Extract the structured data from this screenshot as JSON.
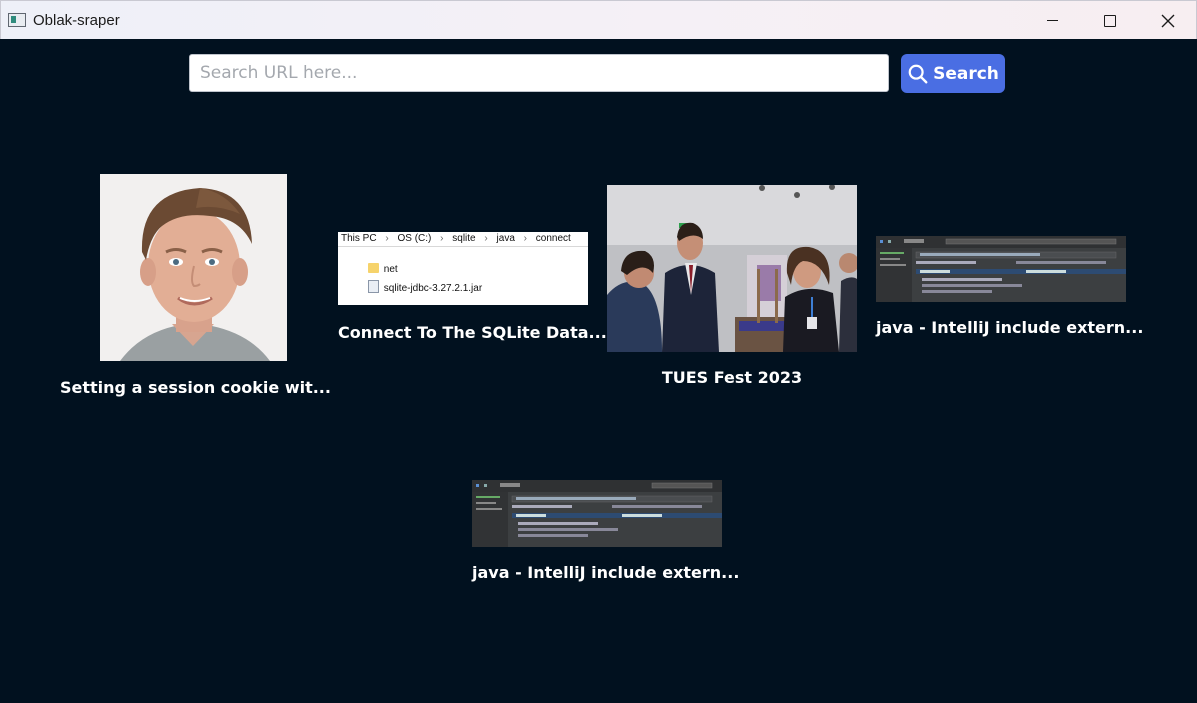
{
  "window": {
    "title": "Oblak-sraper"
  },
  "search": {
    "placeholder": "Search URL here...",
    "value": "",
    "button_label": "Search"
  },
  "colors": {
    "background": "#01111f",
    "accent": "#4a6ee3",
    "caption_text": "#ffffff"
  },
  "results": [
    {
      "title": "Setting a session cookie wit...",
      "thumbnail": "person-portrait"
    },
    {
      "title": "Connect To The SQLite Data...",
      "thumbnail": "file-explorer-screenshot",
      "breadcrumb": [
        "This PC",
        "OS (C:)",
        "sqlite",
        "java",
        "connect"
      ],
      "files": [
        "net",
        "sqlite-jdbc-3.27.2.1.jar"
      ]
    },
    {
      "title": "TUES Fest 2023",
      "thumbnail": "event-photo"
    },
    {
      "title": "java - IntelliJ include extern...",
      "thumbnail": "ide-screenshot"
    },
    {
      "title": "java - IntelliJ include extern...",
      "thumbnail": "ide-screenshot"
    }
  ]
}
